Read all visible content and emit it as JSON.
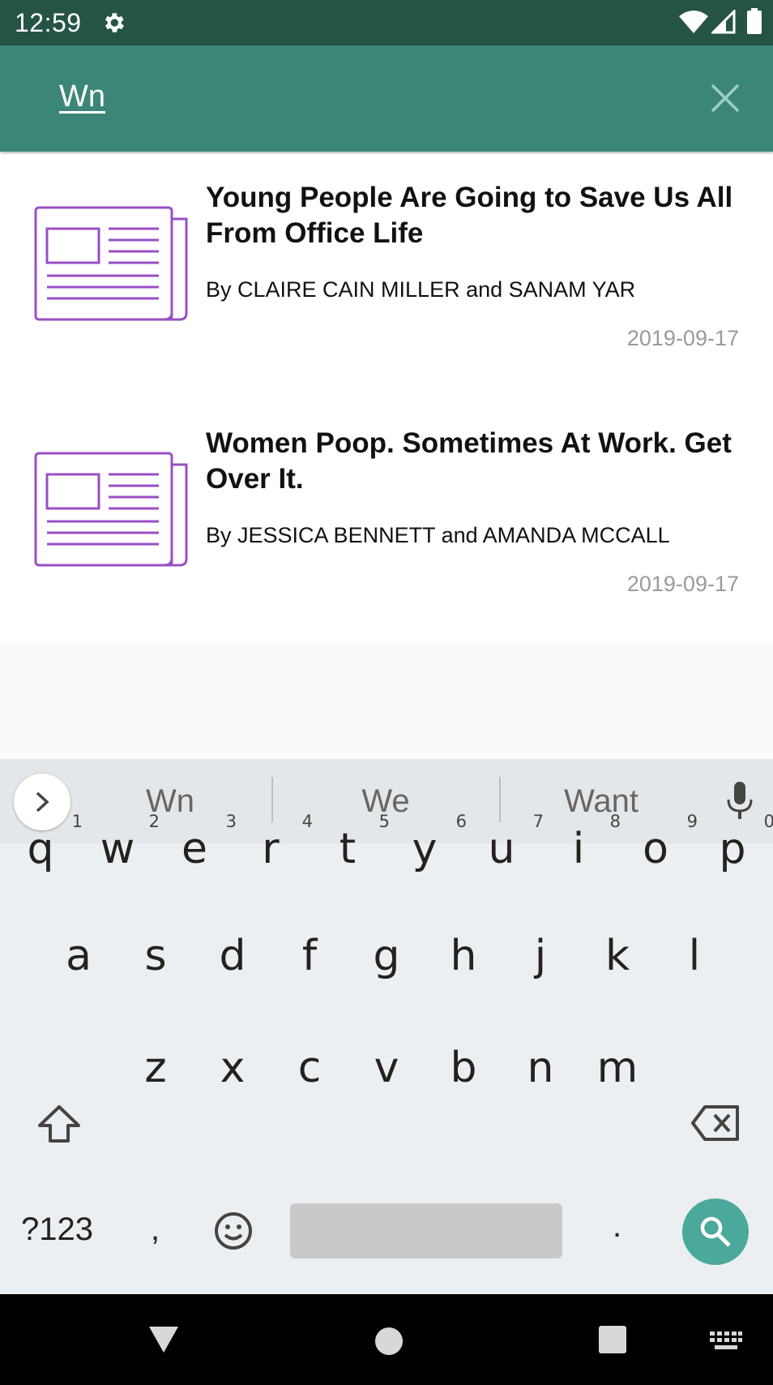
{
  "status_bar": {
    "time": "12:59"
  },
  "search": {
    "query": "Wn"
  },
  "articles": [
    {
      "title": "Young People Are Going to Save Us All From Office Life",
      "byline": "By CLAIRE CAIN MILLER and SANAM YAR",
      "date": "2019-09-17"
    },
    {
      "title": "Women Poop. Sometimes At Work. Get Over It.",
      "byline": "By JESSICA BENNETT and AMANDA MCCALL",
      "date": "2019-09-17"
    }
  ],
  "keyboard": {
    "suggestions": [
      "Wn",
      "We",
      "Want"
    ],
    "row1": [
      {
        "key": "q",
        "hint": "1"
      },
      {
        "key": "w",
        "hint": "2"
      },
      {
        "key": "e",
        "hint": "3"
      },
      {
        "key": "r",
        "hint": "4"
      },
      {
        "key": "t",
        "hint": "5"
      },
      {
        "key": "y",
        "hint": "6"
      },
      {
        "key": "u",
        "hint": "7"
      },
      {
        "key": "i",
        "hint": "8"
      },
      {
        "key": "o",
        "hint": "9"
      },
      {
        "key": "p",
        "hint": "0"
      }
    ],
    "row2": [
      "a",
      "s",
      "d",
      "f",
      "g",
      "h",
      "j",
      "k",
      "l"
    ],
    "row3": [
      "z",
      "x",
      "c",
      "v",
      "b",
      "n",
      "m"
    ],
    "symbols_label": "?123",
    "comma": ",",
    "period": "."
  },
  "colors": {
    "status_bar": "#255446",
    "toolbar": "#3c8677",
    "accent_search_key": "#4aa99a",
    "thumbnail_stroke": "#9a4fc4"
  },
  "icons": [
    "gear-icon",
    "wifi-icon",
    "cell-signal-icon",
    "battery-icon",
    "close-icon",
    "newspaper-icon",
    "chevron-right-icon",
    "mic-icon",
    "shift-icon",
    "backspace-icon",
    "emoji-icon",
    "search-icon",
    "back-icon",
    "home-icon",
    "recents-icon",
    "keyboard-icon"
  ]
}
